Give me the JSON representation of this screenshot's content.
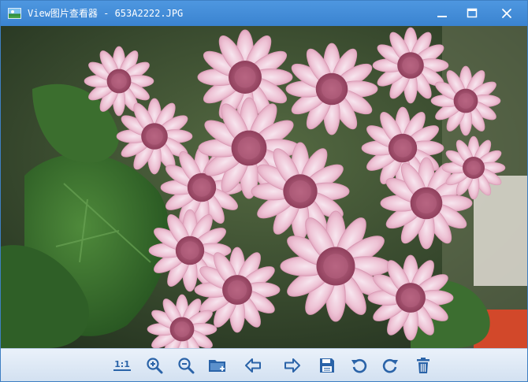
{
  "window": {
    "title": "View图片查看器 - 653A2222.JPG"
  },
  "colors": {
    "titlebar": "#3a83d0",
    "toolbar_icon": "#2a63a8",
    "toolbar_bg": "#dfe9f5"
  },
  "toolbar": {
    "actual_size_label": "1:1",
    "icons": [
      "actual-size-icon",
      "zoom-in-icon",
      "zoom-out-icon",
      "open-folder-icon",
      "previous-arrow-icon",
      "next-arrow-icon",
      "save-icon",
      "rotate-left-icon",
      "rotate-right-icon",
      "delete-icon"
    ]
  }
}
